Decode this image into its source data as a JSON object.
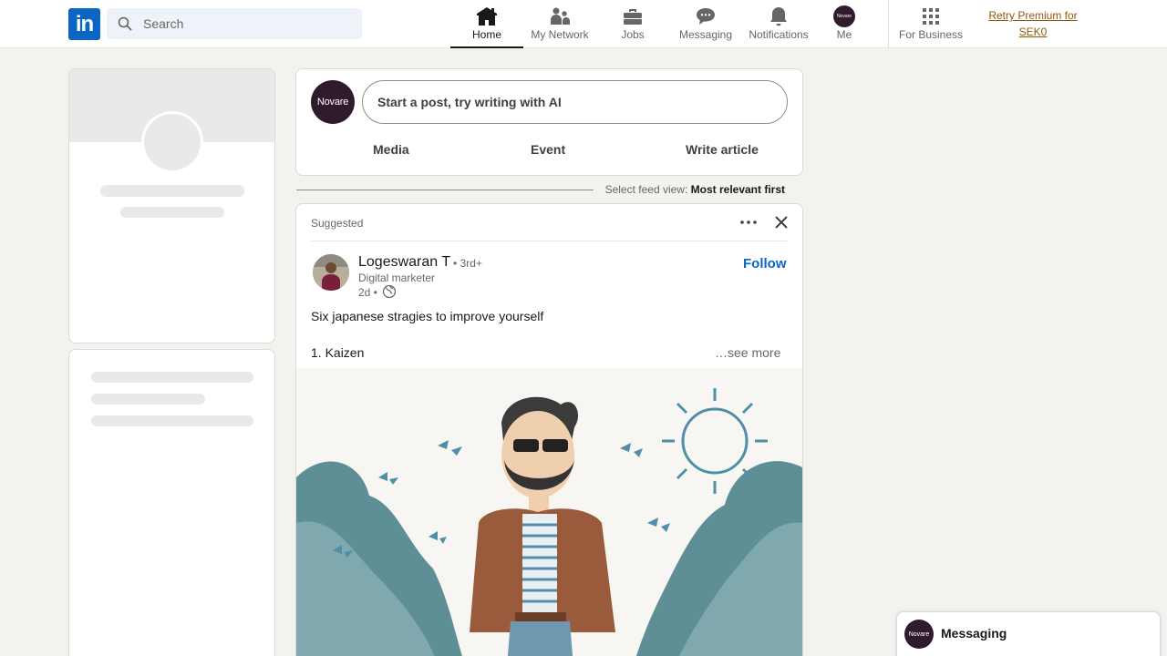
{
  "nav": {
    "logo_text": "in",
    "search_placeholder": "Search",
    "items": [
      {
        "label": "Home",
        "icon": "home-icon",
        "active": true
      },
      {
        "label": "My Network",
        "icon": "network-icon"
      },
      {
        "label": "Jobs",
        "icon": "briefcase-icon"
      },
      {
        "label": "Messaging",
        "icon": "chat-icon"
      },
      {
        "label": "Notifications",
        "icon": "bell-icon"
      },
      {
        "label": "Me",
        "icon": "avatar"
      }
    ],
    "me_avatar_text": "Novare",
    "business_label": "For Business",
    "premium_line1": "Retry Premium for",
    "premium_line2": "SEK0"
  },
  "share": {
    "avatar_text": "Novare",
    "placeholder": "Start a post, try writing with AI",
    "actions": [
      "Media",
      "Event",
      "Write article"
    ]
  },
  "feed_sort": {
    "prefix": "Select feed view:",
    "value": "Most relevant first"
  },
  "post": {
    "suggested_label": "Suggested",
    "author_name": "Logeswaran T",
    "author_degree": "• 3rd+",
    "author_title": "Digital marketer",
    "time": "2d •",
    "follow_label": "Follow",
    "text_line1": "Six japanese stragies to improve yourself",
    "text_line2": "1. Kaizen",
    "see_more": "…see more"
  },
  "messaging": {
    "avatar_text": "Novare",
    "label": "Messaging"
  },
  "colors": {
    "brand": "#0a66c2",
    "premium": "#915907",
    "page_bg": "#f4f2ee",
    "avatar_bg": "#2f1b2c"
  }
}
